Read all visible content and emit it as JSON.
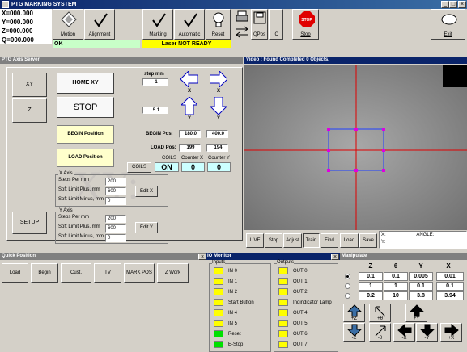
{
  "app": {
    "title": "PTG MARKING SYSTEM"
  },
  "coords": [
    {
      "label": "X=000.000"
    },
    {
      "label": "Y=000.000"
    },
    {
      "label": "Z=000.000"
    },
    {
      "label": "Q=000.000"
    }
  ],
  "toolbar": {
    "motion": "Motion",
    "alignment": "Alignment",
    "marking": "Marking",
    "automatic": "Automatic",
    "reset": "Reset",
    "qpos": "QPos",
    "io": "IO",
    "stop": "Stop",
    "stop_icon": "STOP",
    "exit": "Exit",
    "status_ok": "OK",
    "laser_status": "Laser NOT READY"
  },
  "axis": {
    "header": "PTG Axis Server",
    "xy": "XY",
    "z": "Z",
    "setup": "SETUP",
    "home": "HOME XY",
    "stop": "STOP",
    "begin_pos_btn": "BEGIN Position",
    "load_pos_btn": "LOAD Position",
    "step_label": "step mm",
    "step_value": "1",
    "step2": "5.1",
    "x_label": "X",
    "y_label": "Y",
    "begin_label": "BEGIN Pos:",
    "begin_x": "180.0",
    "begin_y": "400.0",
    "load_label": "LOAD Pos:",
    "load_x": "199",
    "load_y": "194",
    "coils_btn": "COILS",
    "coils_head": "COILS",
    "coils_val": "ON",
    "cx_head": "Counter X",
    "cx_val": "0",
    "cy_head": "Counter Y",
    "cy_val": "0",
    "xaxis": {
      "title": "X Axis",
      "steps_label": "Steps Per mm",
      "steps": "200",
      "plus_label": "Soft Limit Plus, mm",
      "plus": "600",
      "minus_label": "Soft Limit Minus, mm",
      "minus": "0",
      "edit": "Edit X"
    },
    "yaxis": {
      "title": "Y Axis",
      "steps_label": "Steps Per mm",
      "steps": "200",
      "plus_label": "Soft Limit Plus, mm",
      "plus": "600",
      "minus_label": "Soft Limit Minus, mm",
      "minus": "0",
      "edit": "Edit Y"
    },
    "watermark": "XY:"
  },
  "video": {
    "header": "Video : Found Completed 0 Objects.",
    "buttons": [
      "LIVE",
      "Stop",
      "Adjust",
      "Train",
      "Find",
      "Load",
      "Save"
    ],
    "x_readout": "X:",
    "y_readout": "Y:",
    "angle_readout": "ANGLE:"
  },
  "quick": {
    "header": "Quick Position",
    "buttons": [
      "Load",
      "Begin",
      "Cust.",
      "TV",
      "MARK POS",
      "Z Work"
    ]
  },
  "io": {
    "header": "IO Monitor",
    "inputs_title": "Inputs",
    "outputs_title": "Outputs",
    "inputs": [
      {
        "name": "IN 0",
        "state": "yellow"
      },
      {
        "name": "IN 1",
        "state": "yellow"
      },
      {
        "name": "IN 2",
        "state": "yellow"
      },
      {
        "name": "Start Button",
        "state": "yellow"
      },
      {
        "name": "IN 4",
        "state": "yellow"
      },
      {
        "name": "IN 5",
        "state": "yellow"
      },
      {
        "name": "Reset",
        "state": "green"
      },
      {
        "name": "E-Stop",
        "state": "green"
      }
    ],
    "outputs": [
      {
        "name": "OUT 0"
      },
      {
        "name": "OUT 1"
      },
      {
        "name": "OUT 2"
      },
      {
        "name": "Indindicator Lamp"
      },
      {
        "name": "OUT 4"
      },
      {
        "name": "OUT 5"
      },
      {
        "name": "OUT 6"
      },
      {
        "name": "OUT 7"
      }
    ]
  },
  "manip": {
    "header": "Manipulate",
    "cols": [
      "Z",
      "θ",
      "Y",
      "X"
    ],
    "rows": [
      [
        "0.1",
        "0.1",
        "0.005",
        "0.01"
      ],
      [
        "1",
        "1",
        "0.1",
        "0.1"
      ],
      [
        "0.2",
        "10",
        "3.8",
        "3.94"
      ]
    ],
    "labels": {
      "pz": "+Z",
      "mz": "-Z",
      "pt": "+θ",
      "mt": "-θ",
      "py": "+Y",
      "my": "-Y",
      "px": "+X",
      "mx": "-X"
    }
  }
}
